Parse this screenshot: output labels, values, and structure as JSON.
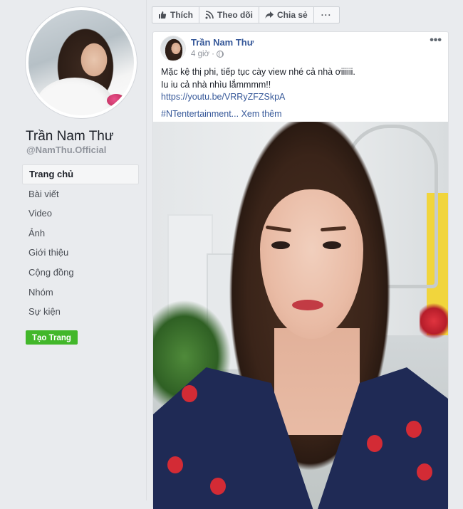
{
  "profile": {
    "name": "Trần Nam Thư",
    "handle": "@NamThu.Official"
  },
  "nav": {
    "items": [
      "Trang chủ",
      "Bài viết",
      "Video",
      "Ảnh",
      "Giới thiệu",
      "Cộng đồng",
      "Nhóm",
      "Sự kiện"
    ],
    "active_index": 0
  },
  "create_page_label": "Tạo Trang",
  "action_bar": {
    "like": "Thích",
    "follow": "Theo dõi",
    "share": "Chia sẻ",
    "more": "···"
  },
  "post": {
    "author": "Trần Nam Thư",
    "time": "4 giờ",
    "separator": "·",
    "options": "•••",
    "lines": [
      "Mặc kệ thị phi, tiếp tục cày view nhé cả nhà ơiiiiii.",
      "Iu iu cả nhà nhìu lắmmmm!!"
    ],
    "link": "https://youtu.be/VRRyZFZSkpA",
    "hashtag": "#NTentertainment",
    "see_more": "... Xem thêm"
  },
  "colors": {
    "link_blue": "#365899",
    "create_green": "#42b72a",
    "background": "#e9ebee"
  }
}
